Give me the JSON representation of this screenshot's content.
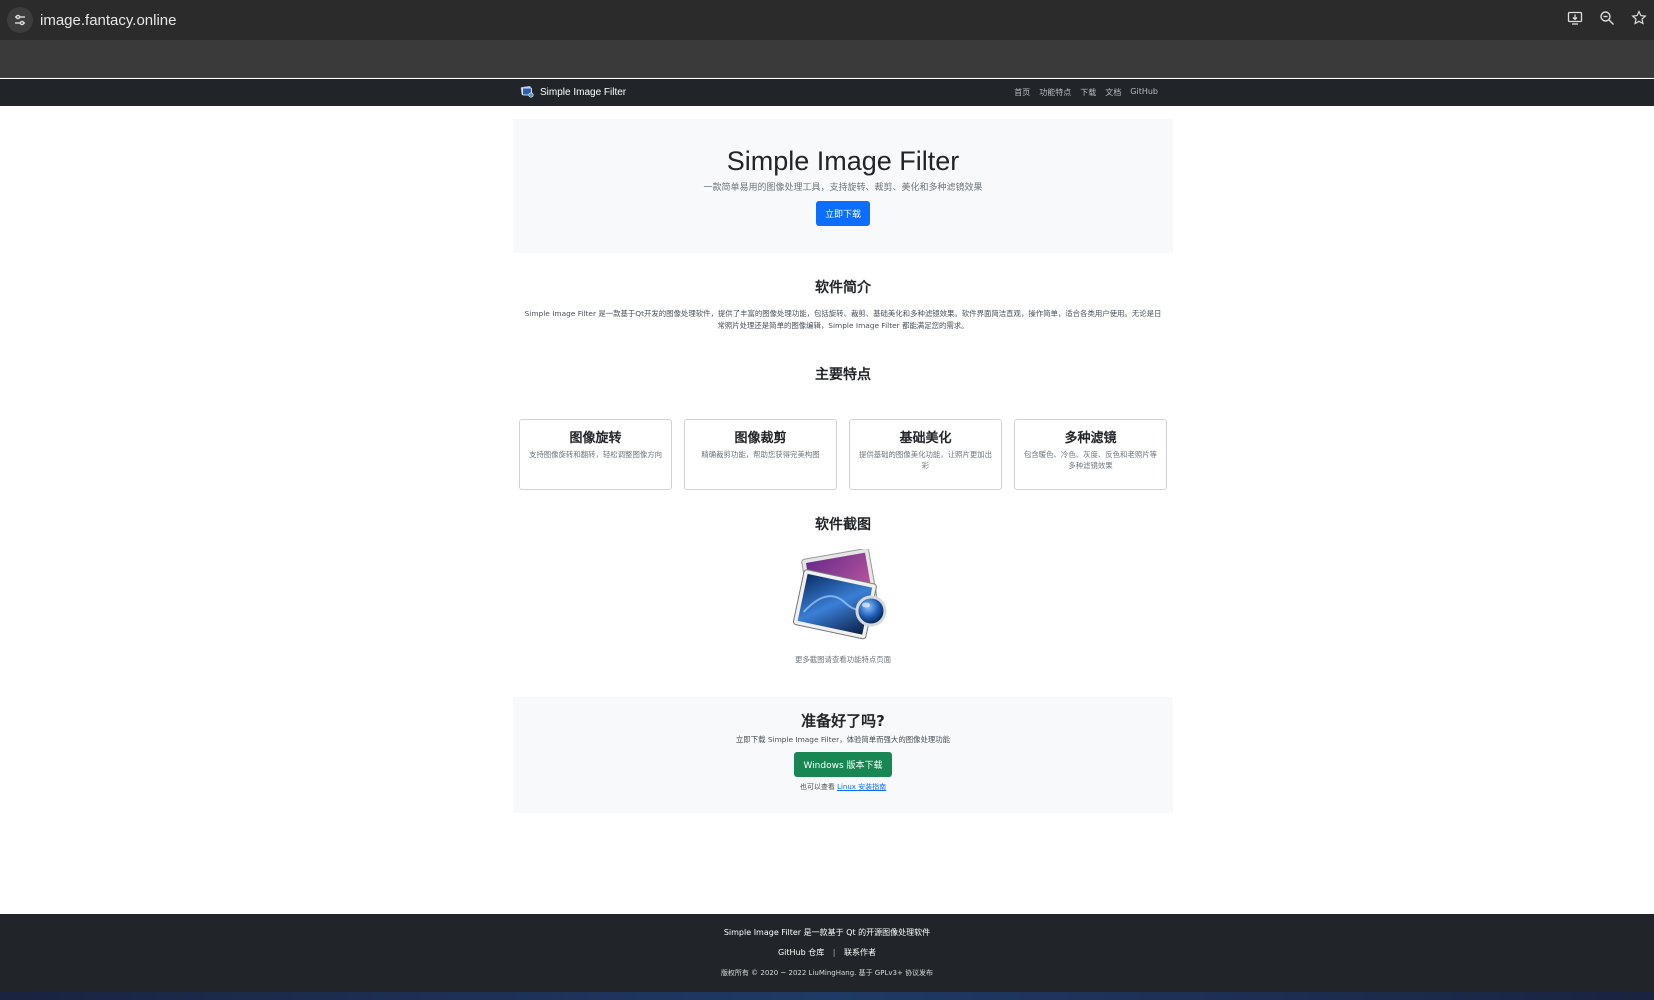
{
  "browser": {
    "url": "image.fantacy.online",
    "icons": [
      "site-info-icon",
      "install-app-icon",
      "zoom-icon",
      "bookmark-star-icon"
    ]
  },
  "navbar": {
    "brand": "Simple Image Filter",
    "links": [
      "首页",
      "功能特点",
      "下载",
      "文档",
      "GitHub"
    ]
  },
  "hero": {
    "title": "Simple Image Filter",
    "subtitle": "一款简单易用的图像处理工具，支持旋转、裁剪、美化和多种滤镜效果",
    "button": "立即下载"
  },
  "intro": {
    "title": "软件简介",
    "text": "Simple Image Filter 是一款基于Qt开发的图像处理软件，提供了丰富的图像处理功能，包括旋转、裁剪、基础美化和多种滤镜效果。软件界面简洁直观，操作简单，适合各类用户使用。无论是日常照片处理还是简单的图像编辑，Simple Image Filter 都能满足您的需求。"
  },
  "features": {
    "title": "主要特点",
    "items": [
      {
        "title": "图像旋转",
        "desc": "支持图像旋转和翻转，轻松调整图像方向"
      },
      {
        "title": "图像裁剪",
        "desc": "精确裁剪功能，帮助您获得完美构图"
      },
      {
        "title": "基础美化",
        "desc": "提供基础的图像美化功能，让照片更加出彩"
      },
      {
        "title": "多种滤镜",
        "desc": "包含暖色、冷色、灰度、反色和老照片等多种滤镜效果"
      }
    ]
  },
  "screenshot": {
    "title": "软件截图",
    "caption": "更多截图请查看功能特点页面"
  },
  "cta": {
    "title": "准备好了吗?",
    "subtitle": "立即下载 Simple Image Filter，体验简单而强大的图像处理功能",
    "button": "Windows 版本下载",
    "note_prefix": "也可以查看",
    "note_link": "Linux 安装指南"
  },
  "footer": {
    "line1": "Simple Image Filter 是一款基于 Qt 的开源图像处理软件",
    "link1": "GitHub 仓库",
    "separator": "|",
    "link2": "联系作者",
    "copyright": "版权所有 © 2020 ~ 2022 LiuMingHang. 基于 GPLv3+ 协议发布"
  },
  "colors": {
    "primary": "#0d6efd",
    "success": "#198754",
    "dark": "#212529",
    "light": "#f8f9fa"
  }
}
